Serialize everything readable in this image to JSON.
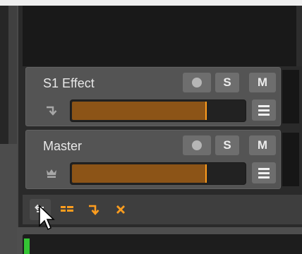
{
  "tracks": [
    {
      "name": "S1 Effect",
      "type_icon": "return-arrow-icon",
      "record_state": "off",
      "solo_label": "S",
      "mute_label": "M",
      "volume": 0.78
    },
    {
      "name": "Master",
      "type_icon": "crown-icon",
      "record_state": "off",
      "solo_label": "S",
      "mute_label": "M",
      "volume": 0.78
    }
  ],
  "toolbar": {
    "buttons": [
      "swap-arrows-icon",
      "chain-icon",
      "return-arrow-icon",
      "close-x-icon"
    ]
  },
  "colors": {
    "accent": "#ff9d1e",
    "meter_green": "#34c434",
    "volume_fill": "#8c5417"
  }
}
